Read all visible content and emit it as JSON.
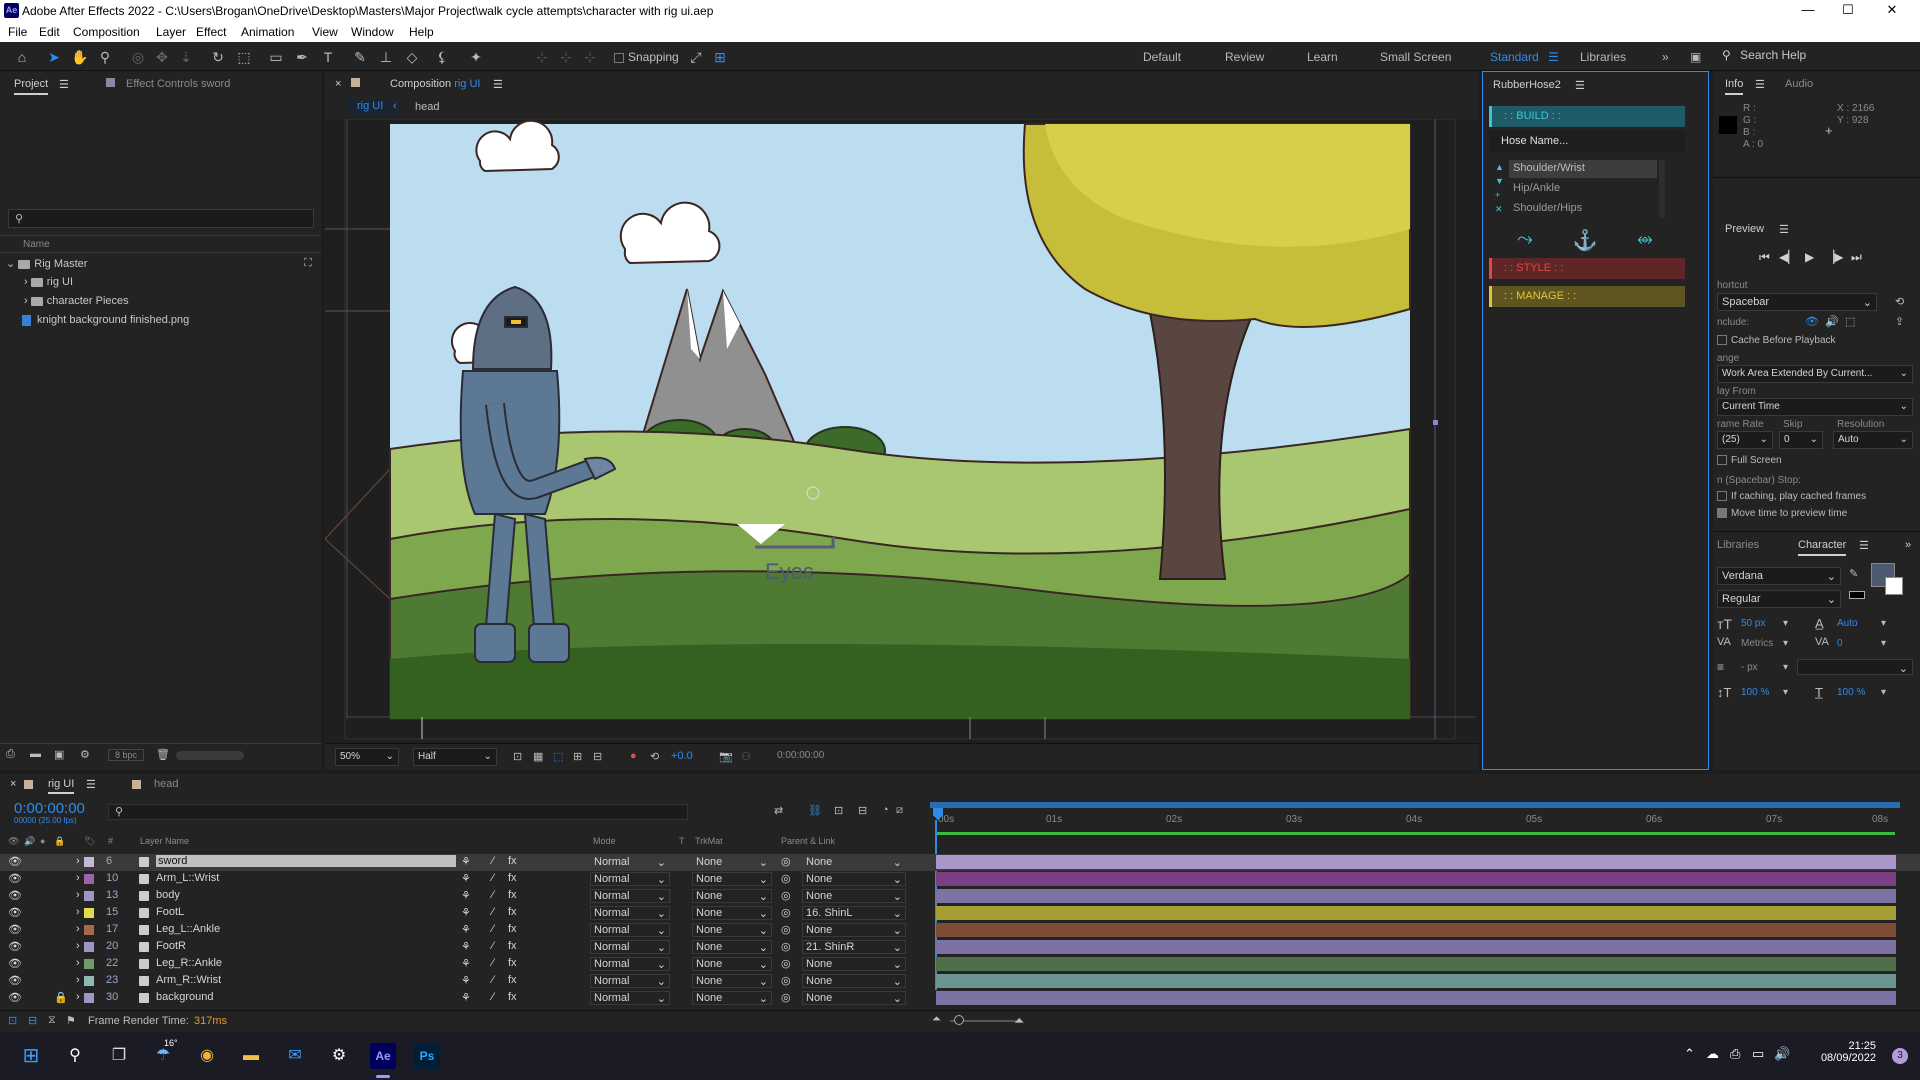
{
  "window": {
    "title": "Adobe After Effects 2022 - C:\\Users\\Brogan\\OneDrive\\Desktop\\Masters\\Major Project\\walk cycle attempts\\character with rig ui.aep",
    "app_icon": "Ae",
    "minimize": "—",
    "maximize": "☐",
    "close": "✕"
  },
  "menu": [
    "File",
    "Edit",
    "Composition",
    "Layer",
    "Effect",
    "Animation",
    "View",
    "Window",
    "Help"
  ],
  "toolbar": {
    "snapping": "Snapping",
    "workspaces": [
      "Default",
      "Review",
      "Learn",
      "Small Screen",
      "Standard",
      "Libraries"
    ],
    "active_workspace": "Standard",
    "search_placeholder": "Search Help"
  },
  "project": {
    "tab": "Project",
    "effect_controls": "Effect Controls sword",
    "name_header": "Name",
    "items": [
      "Rig Master",
      "rig UI",
      "character Pieces",
      "knight background finished.png"
    ],
    "bpc": "8 bpc"
  },
  "composition": {
    "tab_label": "Composition",
    "tab_name": "rig UI",
    "breadcrumb": [
      "rig UI",
      "head"
    ],
    "zoom": "50%",
    "resolution": "Half",
    "time": "0:00:00:00",
    "exposure": "+0.0",
    "annotation": "Eyes"
  },
  "rubberhose": {
    "title": "RubberHose2",
    "build": "BUILD",
    "hose_name": "Hose Name...",
    "options": [
      "Shoulder/Wrist",
      "Hip/Ankle",
      "Shoulder/Hips"
    ],
    "style": "STYLE",
    "manage": "MANAGE"
  },
  "info": {
    "tab": "Info",
    "audio_tab": "Audio",
    "r": "R :",
    "g": "G :",
    "b": "B :",
    "a": "A : 0",
    "x": "X : 2166",
    "y": "Y : 928"
  },
  "preview": {
    "tab": "Preview",
    "shortcut_label": "hortcut",
    "shortcut": "Spacebar",
    "include_label": "nclude:",
    "cache_before": "Cache Before Playback",
    "range_label": "ange",
    "range": "Work Area Extended By Current...",
    "play_from_label": "lay From",
    "play_from": "Current Time",
    "frame_rate_label": "rame Rate",
    "skip_label": "Skip",
    "resolution_label": "Resolution",
    "frame_rate": "(25)",
    "skip": "0",
    "resolution": "Auto",
    "full_screen": "Full Screen",
    "stop_label": "n (Spacebar) Stop:",
    "if_caching": "If caching, play cached frames",
    "move_time": "Move time to preview time"
  },
  "character": {
    "libraries_tab": "Libraries",
    "tab": "Character",
    "font": "Verdana",
    "style": "Regular",
    "size": "50 px",
    "leading": "Auto",
    "kerning": "Metrics",
    "tracking": "0",
    "indent": "- px",
    "vscale": "100 %",
    "hscale": "100 %"
  },
  "timeline": {
    "tab_rig": "rig UI",
    "tab_head": "head",
    "timecode": "0:00:00:00",
    "fps": "00000 (25.00 fps)",
    "headers": {
      "num": "#",
      "layer_name": "Layer Name",
      "mode": "Mode",
      "t": "T",
      "trkmat": "TrkMat",
      "parent": "Parent & Link"
    },
    "ruler": [
      "00s",
      "01s",
      "02s",
      "03s",
      "04s",
      "05s",
      "06s",
      "07s",
      "08s"
    ],
    "layers": [
      {
        "num": "6",
        "name": "sword",
        "mode": "Normal",
        "trkmat": "None",
        "parent": "None",
        "color": "#c4b8d6",
        "bar": "#a997c9"
      },
      {
        "num": "10",
        "name": "Arm_L::Wrist",
        "mode": "Normal",
        "trkmat": "None",
        "parent": "None",
        "color": "#9e62a8",
        "bar": "#7a3f85"
      },
      {
        "num": "13",
        "name": "body",
        "mode": "Normal",
        "trkmat": "None",
        "parent": "None",
        "color": "#9f95c3",
        "bar": "#7d73a3"
      },
      {
        "num": "15",
        "name": "FootL",
        "mode": "Normal",
        "trkmat": "None",
        "parent": "16. ShinL",
        "color": "#e4d84c",
        "bar": "#a59e35"
      },
      {
        "num": "17",
        "name": "Leg_L::Ankle",
        "mode": "Normal",
        "trkmat": "None",
        "parent": "None",
        "color": "#a8684c",
        "bar": "#7d4d37"
      },
      {
        "num": "20",
        "name": "FootR",
        "mode": "Normal",
        "trkmat": "None",
        "parent": "21. ShinR",
        "color": "#9f95c3",
        "bar": "#7d73a3"
      },
      {
        "num": "22",
        "name": "Leg_R::Ankle",
        "mode": "Normal",
        "trkmat": "None",
        "parent": "None",
        "color": "#6f9b68",
        "bar": "#4f6f4a"
      },
      {
        "num": "23",
        "name": "Arm_R::Wrist",
        "mode": "Normal",
        "trkmat": "None",
        "parent": "None",
        "color": "#8eb9b0",
        "bar": "#6a9590"
      },
      {
        "num": "30",
        "name": "background",
        "mode": "Normal",
        "trkmat": "None",
        "parent": "None",
        "color": "#9f95c3",
        "bar": "#7d73a3"
      }
    ],
    "render_label": "Frame Render Time:",
    "render_time": "317ms"
  },
  "taskbar": {
    "weather": "16°",
    "ae": "Ae",
    "ps": "Ps",
    "time": "21:25",
    "date": "08/09/2022",
    "notifications": "3"
  }
}
